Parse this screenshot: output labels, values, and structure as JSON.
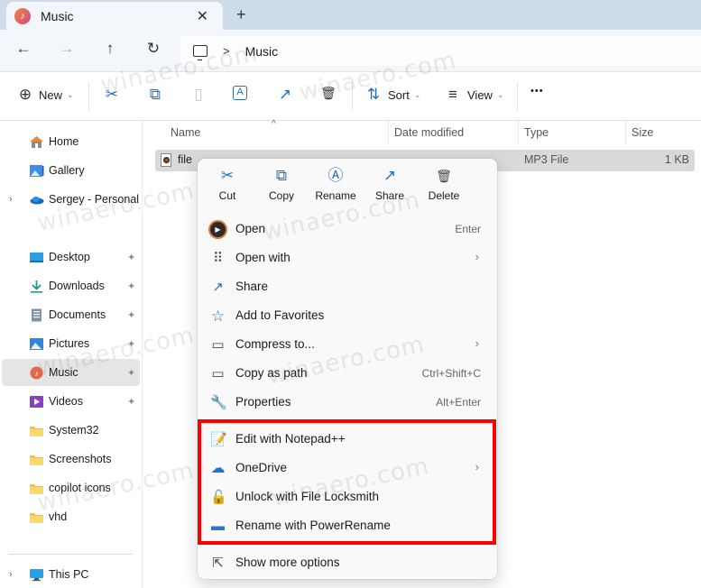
{
  "window": {
    "tab_title": "Music",
    "close_tab_glyph": "✕",
    "new_tab_glyph": "+"
  },
  "nav": {
    "back_glyph": "←",
    "forward_glyph": "→",
    "up_glyph": "↑",
    "refresh_glyph": "↻",
    "breadcrumb_sep": ">",
    "breadcrumb": [
      "Music"
    ]
  },
  "toolbar": {
    "new_label": "New",
    "sort_label": "Sort",
    "view_label": "View",
    "more_glyph": "•••",
    "icons": {
      "new": "⊕",
      "cut": "✂",
      "copy": "⧉",
      "paste": "▯",
      "rename": "A",
      "share": "↗",
      "delete": "🗑",
      "sort": "⇅",
      "view": "≡"
    }
  },
  "sidebar": {
    "items": [
      {
        "label": "Home",
        "icon": "home-icon",
        "expand": false,
        "pinned": false
      },
      {
        "label": "Gallery",
        "icon": "gallery-icon",
        "expand": false,
        "pinned": false
      },
      {
        "label": "Sergey - Personal",
        "icon": "onedrive-icon",
        "expand": true,
        "pinned": false
      },
      {
        "label": "Desktop",
        "icon": "desktop-icon",
        "expand": false,
        "pinned": true
      },
      {
        "label": "Downloads",
        "icon": "downloads-icon",
        "expand": false,
        "pinned": true
      },
      {
        "label": "Documents",
        "icon": "documents-icon",
        "expand": false,
        "pinned": true
      },
      {
        "label": "Pictures",
        "icon": "pictures-icon",
        "expand": false,
        "pinned": true
      },
      {
        "label": "Music",
        "icon": "music-icon",
        "expand": false,
        "pinned": true,
        "selected": true
      },
      {
        "label": "Videos",
        "icon": "videos-icon",
        "expand": false,
        "pinned": true
      },
      {
        "label": "System32",
        "icon": "folder-icon",
        "expand": false,
        "pinned": false
      },
      {
        "label": "Screenshots",
        "icon": "folder-icon",
        "expand": false,
        "pinned": false
      },
      {
        "label": "copilot icons",
        "icon": "folder-icon",
        "expand": false,
        "pinned": false
      },
      {
        "label": "vhd",
        "icon": "folder-icon",
        "expand": false,
        "pinned": false
      },
      {
        "label": "This PC",
        "icon": "this-pc-icon",
        "expand": true,
        "pinned": false
      }
    ],
    "expand_glyph": "›",
    "pin_glyph": "📌"
  },
  "filelist": {
    "columns": [
      "Name",
      "Date modified",
      "Type",
      "Size"
    ],
    "sort_glyph": "^",
    "rows": [
      {
        "name": "file",
        "date": "",
        "type": "MP3 File",
        "size": "1 KB"
      }
    ]
  },
  "context_menu": {
    "quick_actions": [
      {
        "label": "Cut",
        "glyph": "✂"
      },
      {
        "label": "Copy",
        "glyph": "⧉"
      },
      {
        "label": "Rename",
        "glyph": "Ⓐ"
      },
      {
        "label": "Share",
        "glyph": "↗"
      },
      {
        "label": "Delete",
        "glyph": "🗑"
      }
    ],
    "items": [
      {
        "label": "Open",
        "shortcut": "Enter",
        "submenu": false,
        "glyph": "▶"
      },
      {
        "label": "Open with",
        "shortcut": "",
        "submenu": true,
        "glyph": "⠿"
      },
      {
        "label": "Share",
        "shortcut": "",
        "submenu": false,
        "glyph": "↗"
      },
      {
        "label": "Add to Favorites",
        "shortcut": "",
        "submenu": false,
        "glyph": "☆"
      },
      {
        "label": "Compress to...",
        "shortcut": "",
        "submenu": true,
        "glyph": "▭"
      },
      {
        "label": "Copy as path",
        "shortcut": "Ctrl+Shift+C",
        "submenu": false,
        "glyph": "▭"
      },
      {
        "label": "Properties",
        "shortcut": "Alt+Enter",
        "submenu": false,
        "glyph": "🔧"
      }
    ],
    "extension_items": [
      {
        "label": "Edit with Notepad++",
        "submenu": false,
        "glyph": "📝"
      },
      {
        "label": "OneDrive",
        "submenu": true,
        "glyph": "☁"
      },
      {
        "label": "Unlock with File Locksmith",
        "submenu": false,
        "glyph": "🔓"
      },
      {
        "label": "Rename with PowerRename",
        "submenu": false,
        "glyph": "▬"
      }
    ],
    "footer_item": {
      "label": "Show more options",
      "glyph": "⇱"
    },
    "submenu_glyph": "›",
    "highlight_color": "#ff0000"
  },
  "watermark": "winaero.com",
  "colors": {
    "accent": "#2b6cb8",
    "titlebar": "#cfdcea",
    "selection": "#d9d9d9"
  }
}
